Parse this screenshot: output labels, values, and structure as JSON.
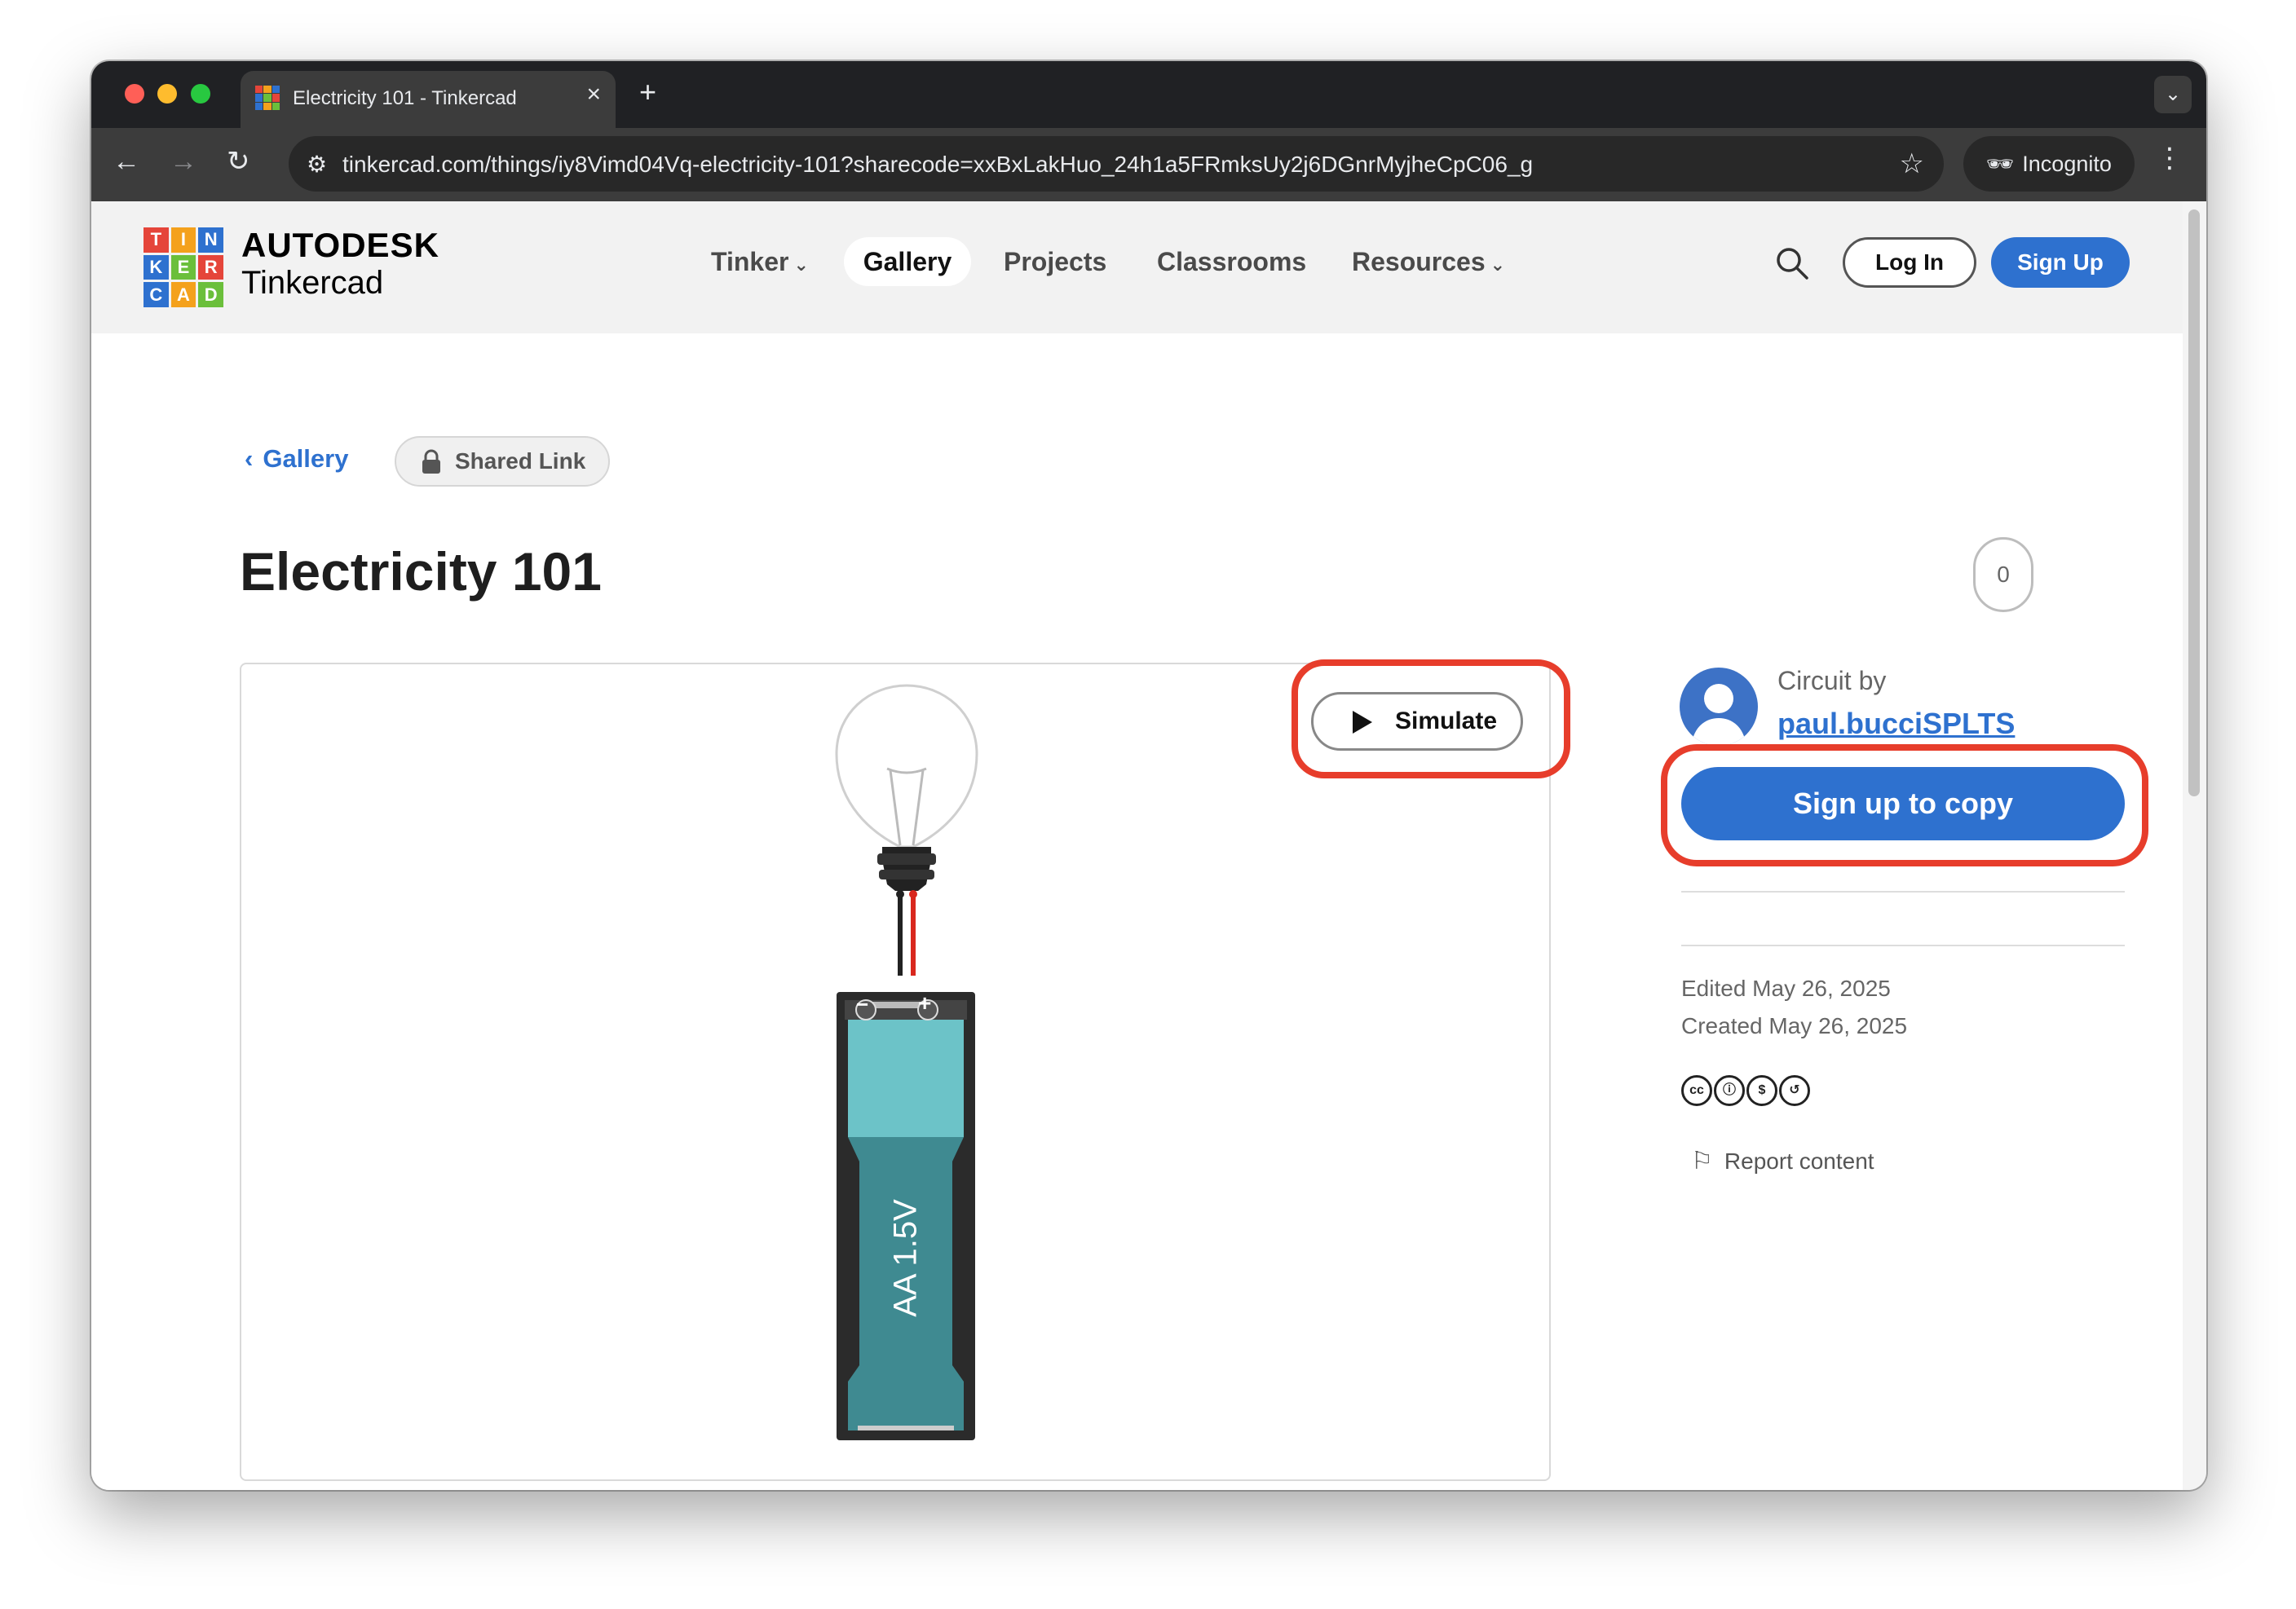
{
  "browser": {
    "tab_title": "Electricity 101 - Tinkercad",
    "tab_close": "×",
    "new_tab": "+",
    "url": "tinkercad.com/things/iy8Vimd04Vq-electricity-101?sharecode=xxBxLakHuo_24h1a5FRmksUy2j6DGnrMyjheCpC06_g",
    "incognito_label": "Incognito",
    "icons": [
      "back-icon",
      "forward-icon",
      "reload-icon",
      "site-info-icon",
      "bookmark-star-icon",
      "incognito-icon",
      "kebab-menu-icon",
      "tab-list-icon"
    ]
  },
  "header": {
    "logo_letters": [
      "T",
      "I",
      "N",
      "K",
      "E",
      "R",
      "C",
      "A",
      "D"
    ],
    "logo_colors": [
      "#e5453a",
      "#f4a11c",
      "#2e71cf",
      "#2e71cf",
      "#6bbf3b",
      "#e5453a",
      "#2e71cf",
      "#f4a11c",
      "#6bbf3b"
    ],
    "brand_top": "AUTODESK",
    "brand_bottom": "Tinkercad",
    "nav": {
      "tinker": "Tinker",
      "gallery": "Gallery",
      "projects": "Projects",
      "classrooms": "Classrooms",
      "resources": "Resources"
    },
    "login": "Log In",
    "signup": "Sign Up"
  },
  "breadcrumb": {
    "back_label": "Gallery",
    "shared_label": "Shared Link"
  },
  "design": {
    "title": "Electricity 101",
    "like_count": "0",
    "simulate_label": "Simulate",
    "battery_label": "AA 1.5V",
    "battery_minus": "−",
    "battery_plus": "+"
  },
  "sidebar": {
    "circuit_by": "Circuit by",
    "author": "paul.bucciSPLTS",
    "copy_button": "Sign up to copy",
    "edited": "Edited May 26, 2025",
    "created": "Created May 26, 2025",
    "license_icons": [
      "cc",
      "by",
      "nc",
      "sa"
    ],
    "license_glyphs": [
      "cc",
      "ⓘ",
      "$",
      "↺"
    ],
    "report": "Report content"
  },
  "colors": {
    "accent": "#2e71cf",
    "highlight_ring": "#e73d2b",
    "battery_top": "#6cc3c8",
    "battery_body": "#3f8a91"
  }
}
